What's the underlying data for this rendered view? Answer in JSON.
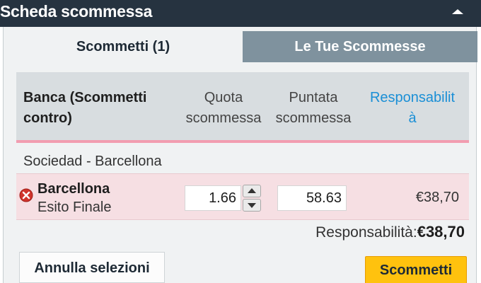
{
  "header": {
    "title": "Scheda scommessa"
  },
  "tabs": [
    {
      "label": "Scommetti (1)"
    },
    {
      "label": "Le Tue Scommesse"
    }
  ],
  "table": {
    "columns": {
      "name_line1": "Banca (Scommetti",
      "name_line2": "contro)",
      "odds_line1": "Quota",
      "odds_line2": "scommessa",
      "stake_line1": "Puntata",
      "stake_line2": "scommessa",
      "liability_line1": "Responsabilit",
      "liability_line2": "à"
    },
    "event": "Sociedad - Barcellona",
    "selection": {
      "name": "Barcellona",
      "market": "Esito Finale",
      "odds": "1.66",
      "stake": "58.63",
      "liability": "€38,70"
    }
  },
  "total": {
    "label": "Responsabilità:",
    "value": "€38,70"
  },
  "buttons": {
    "cancel": "Annulla selezioni",
    "submit": "Scommetti"
  },
  "icons": {
    "toggle": "chevron-up-icon",
    "remove": "remove-circle-icon",
    "step_up": "arrow-up-icon",
    "step_down": "arrow-down-icon"
  },
  "colors": {
    "header_bg": "#263340",
    "inactive_tab_bg": "#7f929e",
    "liability_header": "#1a8fd6",
    "lay_row_bg": "#f6dfe3",
    "lay_accent": "#f29db0",
    "submit_button": "#ffc20e"
  }
}
